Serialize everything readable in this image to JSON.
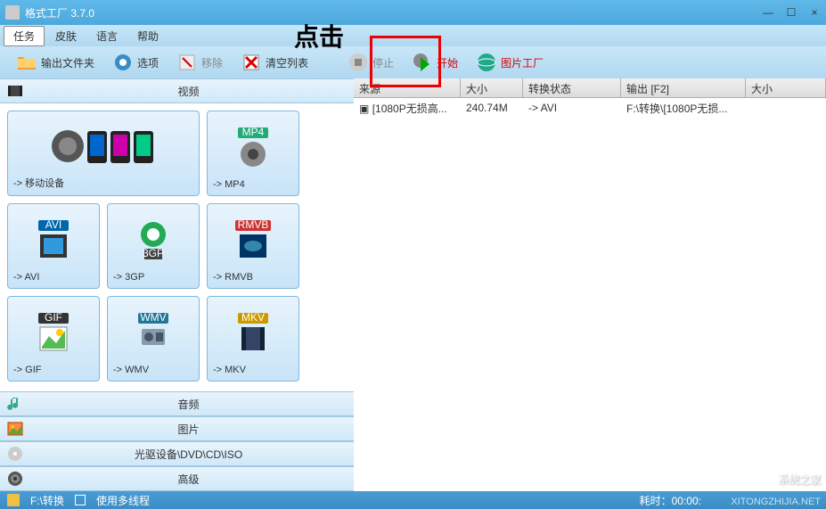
{
  "window": {
    "title": "格式工厂 3.7.0",
    "min": "—",
    "max": "☐",
    "close": "×"
  },
  "menu": {
    "items": [
      "任务",
      "皮肤",
      "语言",
      "帮助"
    ]
  },
  "annotation": "点击",
  "toolbar": {
    "output_folder": "输出文件夹",
    "options": "选项",
    "remove": "移除",
    "clear_list": "清空列表",
    "stop": "停止",
    "start": "开始",
    "image_factory": "图片工厂"
  },
  "categories": {
    "video": "视频",
    "audio": "音频",
    "image": "图片",
    "disc": "光驱设备\\DVD\\CD\\ISO",
    "advanced": "高级"
  },
  "formats": {
    "mobile": "-> 移动设备",
    "mp4": "-> MP4",
    "avi": "-> AVI",
    "3gp": "-> 3GP",
    "rmvb": "-> RMVB",
    "gif": "-> GIF",
    "wmv": "-> WMV",
    "mkv": "-> MKV"
  },
  "list": {
    "columns": {
      "source": "来源",
      "size": "大小",
      "status": "转换状态",
      "output": "输出 [F2]",
      "size2": "大小"
    },
    "rows": [
      {
        "source": "[1080P无损高...",
        "size": "240.74M",
        "status": "-> AVI",
        "output": "F:\\转换\\[1080P无损..."
      }
    ]
  },
  "statusbar": {
    "output_path": "F:\\转换",
    "multithread": "使用多线程",
    "elapsed": "耗时：00:00:"
  },
  "watermark": {
    "text": "系统之家",
    "url": "XITONGZHIJIA.NET"
  },
  "colors": {
    "primary": "#4da8dc",
    "accent_red": "#e00",
    "panel_bg": "#c8e6f8"
  }
}
